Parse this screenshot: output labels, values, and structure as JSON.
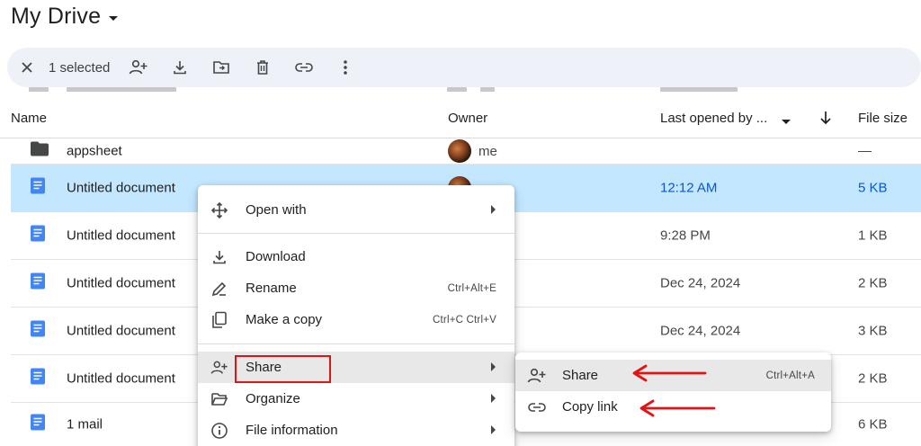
{
  "title": "My Drive",
  "toolbar": {
    "selected_count": "1 selected",
    "icons": [
      "close-icon",
      "add-person-icon",
      "download-icon",
      "move-to-folder-icon",
      "trash-icon",
      "link-icon",
      "more-vert-icon"
    ]
  },
  "columns": {
    "name": "Name",
    "owner": "Owner",
    "last_opened": "Last opened by ...",
    "file_size": "File size"
  },
  "rows": [
    {
      "name": "appsheet",
      "owner": "me",
      "date": "",
      "size": "—",
      "type": "folder"
    },
    {
      "name": "Untitled document",
      "owner": "me",
      "date": "12:12 AM",
      "size": "5 KB",
      "type": "doc",
      "selected": true
    },
    {
      "name": "Untitled document",
      "owner": "",
      "date": "9:28 PM",
      "size": "1 KB",
      "type": "doc"
    },
    {
      "name": "Untitled document",
      "owner": "",
      "date": "Dec 24, 2024",
      "size": "2 KB",
      "type": "doc"
    },
    {
      "name": "Untitled document",
      "owner": "",
      "date": "Dec 24, 2024",
      "size": "3 KB",
      "type": "doc"
    },
    {
      "name": "Untitled document",
      "owner": "",
      "date": "",
      "size": "2 KB",
      "type": "doc"
    },
    {
      "name": "1 mail",
      "owner": "",
      "date": "",
      "size": "6 KB",
      "type": "doc"
    }
  ],
  "context_menu": {
    "open_with": "Open with",
    "download": "Download",
    "rename": "Rename",
    "rename_shortcut": "Ctrl+Alt+E",
    "make_copy": "Make a copy",
    "make_copy_shortcut": "Ctrl+C Ctrl+V",
    "share": "Share",
    "organize": "Organize",
    "file_information": "File information"
  },
  "share_submenu": {
    "share": "Share",
    "share_shortcut": "Ctrl+Alt+A",
    "copy_link": "Copy link"
  },
  "colors": {
    "selected_row": "#c2e7ff",
    "toolbar_bg": "#eef2f8",
    "doc_blue": "#4285f4",
    "annotation_red": "#e01414"
  }
}
